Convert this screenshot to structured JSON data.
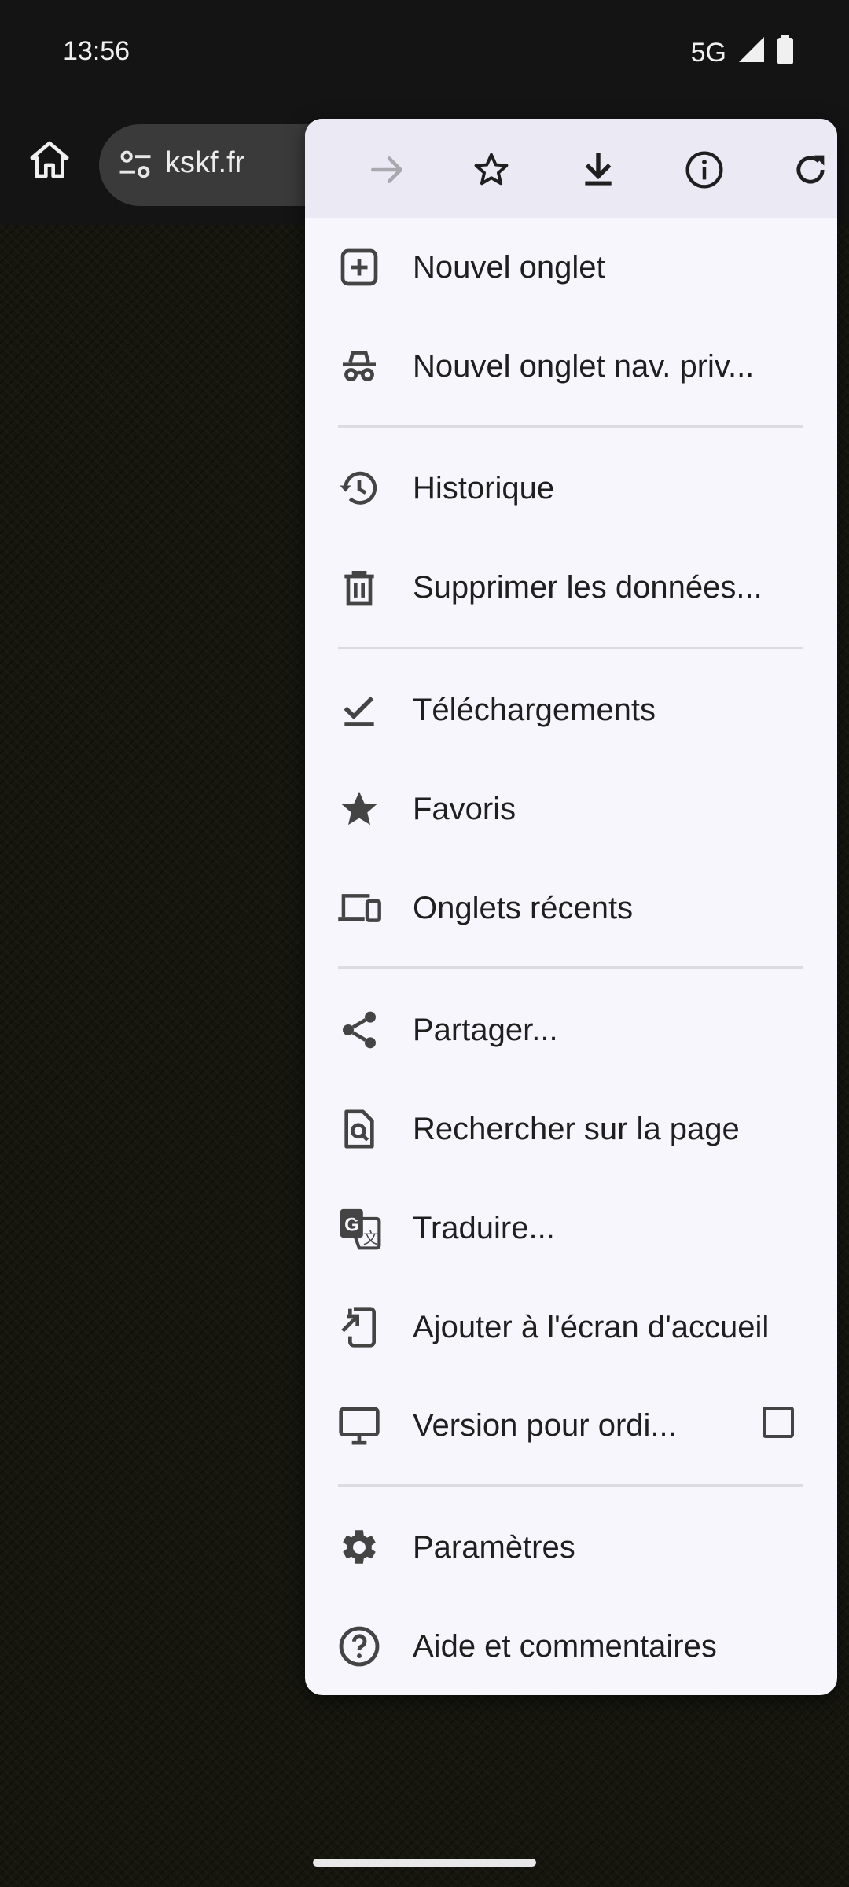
{
  "status_bar": {
    "time": "13:56",
    "network": "5G"
  },
  "toolbar": {
    "url": "kskf.fr"
  },
  "menu": {
    "top_icons": [
      "forward-icon",
      "bookmark-star-icon",
      "download-icon",
      "info-icon",
      "reload-icon"
    ],
    "items": [
      {
        "label": "Nouvel onglet",
        "icon": "new-tab-icon"
      },
      {
        "label": "Nouvel onglet nav. priv...",
        "icon": "incognito-icon"
      },
      {
        "label": "Historique",
        "icon": "history-icon"
      },
      {
        "label": "Supprimer les données...",
        "icon": "trash-icon"
      },
      {
        "label": "Téléchargements",
        "icon": "downloads-icon"
      },
      {
        "label": "Favoris",
        "icon": "star-icon"
      },
      {
        "label": "Onglets récents",
        "icon": "devices-icon"
      },
      {
        "label": "Partager...",
        "icon": "share-icon"
      },
      {
        "label": "Rechercher sur la page",
        "icon": "find-in-page-icon"
      },
      {
        "label": "Traduire...",
        "icon": "translate-icon"
      },
      {
        "label": "Ajouter à l'écran d'accueil",
        "icon": "add-to-home-icon"
      },
      {
        "label": "Version pour ordi...",
        "icon": "desktop-icon",
        "checked": false
      },
      {
        "label": "Paramètres",
        "icon": "settings-icon"
      },
      {
        "label": "Aide et commentaires",
        "icon": "help-icon"
      }
    ]
  },
  "colors": {
    "menu_bg": "#f7f6fc",
    "menu_top_bg": "#ebeaf4",
    "icon": "#444444",
    "toolbar_bg": "#141414"
  }
}
